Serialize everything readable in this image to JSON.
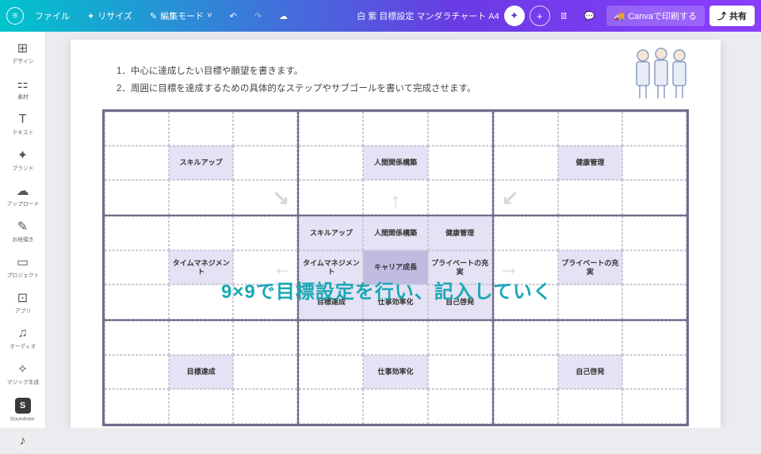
{
  "topbar": {
    "file": "ファイル",
    "resize": "リサイズ",
    "editmode": "編集モード",
    "doctitle": "白 紫 目標設定 マンダラチャート A4",
    "print": "Canvaで印刷する",
    "share": "共有"
  },
  "sidebar": {
    "items": [
      {
        "icon": "⊞",
        "label": "デザイン"
      },
      {
        "icon": "⚏",
        "label": "素材"
      },
      {
        "icon": "T",
        "label": "テキスト"
      },
      {
        "icon": "✦",
        "label": "ブランド"
      },
      {
        "icon": "☁",
        "label": "アップロード"
      },
      {
        "icon": "✎",
        "label": "お絵描き"
      },
      {
        "icon": "▭",
        "label": "プロジェクト"
      },
      {
        "icon": "⊡",
        "label": "アプリ"
      },
      {
        "icon": "♫",
        "label": "オーディオ"
      },
      {
        "icon": "✧",
        "label": "マジック生成"
      },
      {
        "icon": "S",
        "label": "Soundraw"
      },
      {
        "icon": "♪",
        "label": ""
      }
    ]
  },
  "instructions": {
    "line1": "1．中心に達成したい目標や願望を書きます。",
    "line2": "2．周囲に目標を達成するための具体的なステップやサブゴールを書いて完成させます。"
  },
  "mandala": {
    "tl": {
      "center": "スキルアップ"
    },
    "tc": {
      "center": "人間関係構築"
    },
    "tr": {
      "center": "健康管理"
    },
    "ml": {
      "center": "タイムマネジメント"
    },
    "mc": {
      "c1": "スキルアップ",
      "c2": "人間関係構築",
      "c3": "健康管理",
      "c4": "タイムマネジメント",
      "c5": "キャリア成長",
      "c6": "プライベートの充実",
      "c7": "目標達成",
      "c8": "仕事効率化",
      "c9": "自己啓発"
    },
    "mr": {
      "center": "プライベートの充実"
    },
    "bl": {
      "center": "目標達成"
    },
    "bc": {
      "center": "仕事効率化"
    },
    "br": {
      "center": "自己啓発"
    }
  },
  "overlay": "9×9で目標設定を行い、記入していく"
}
